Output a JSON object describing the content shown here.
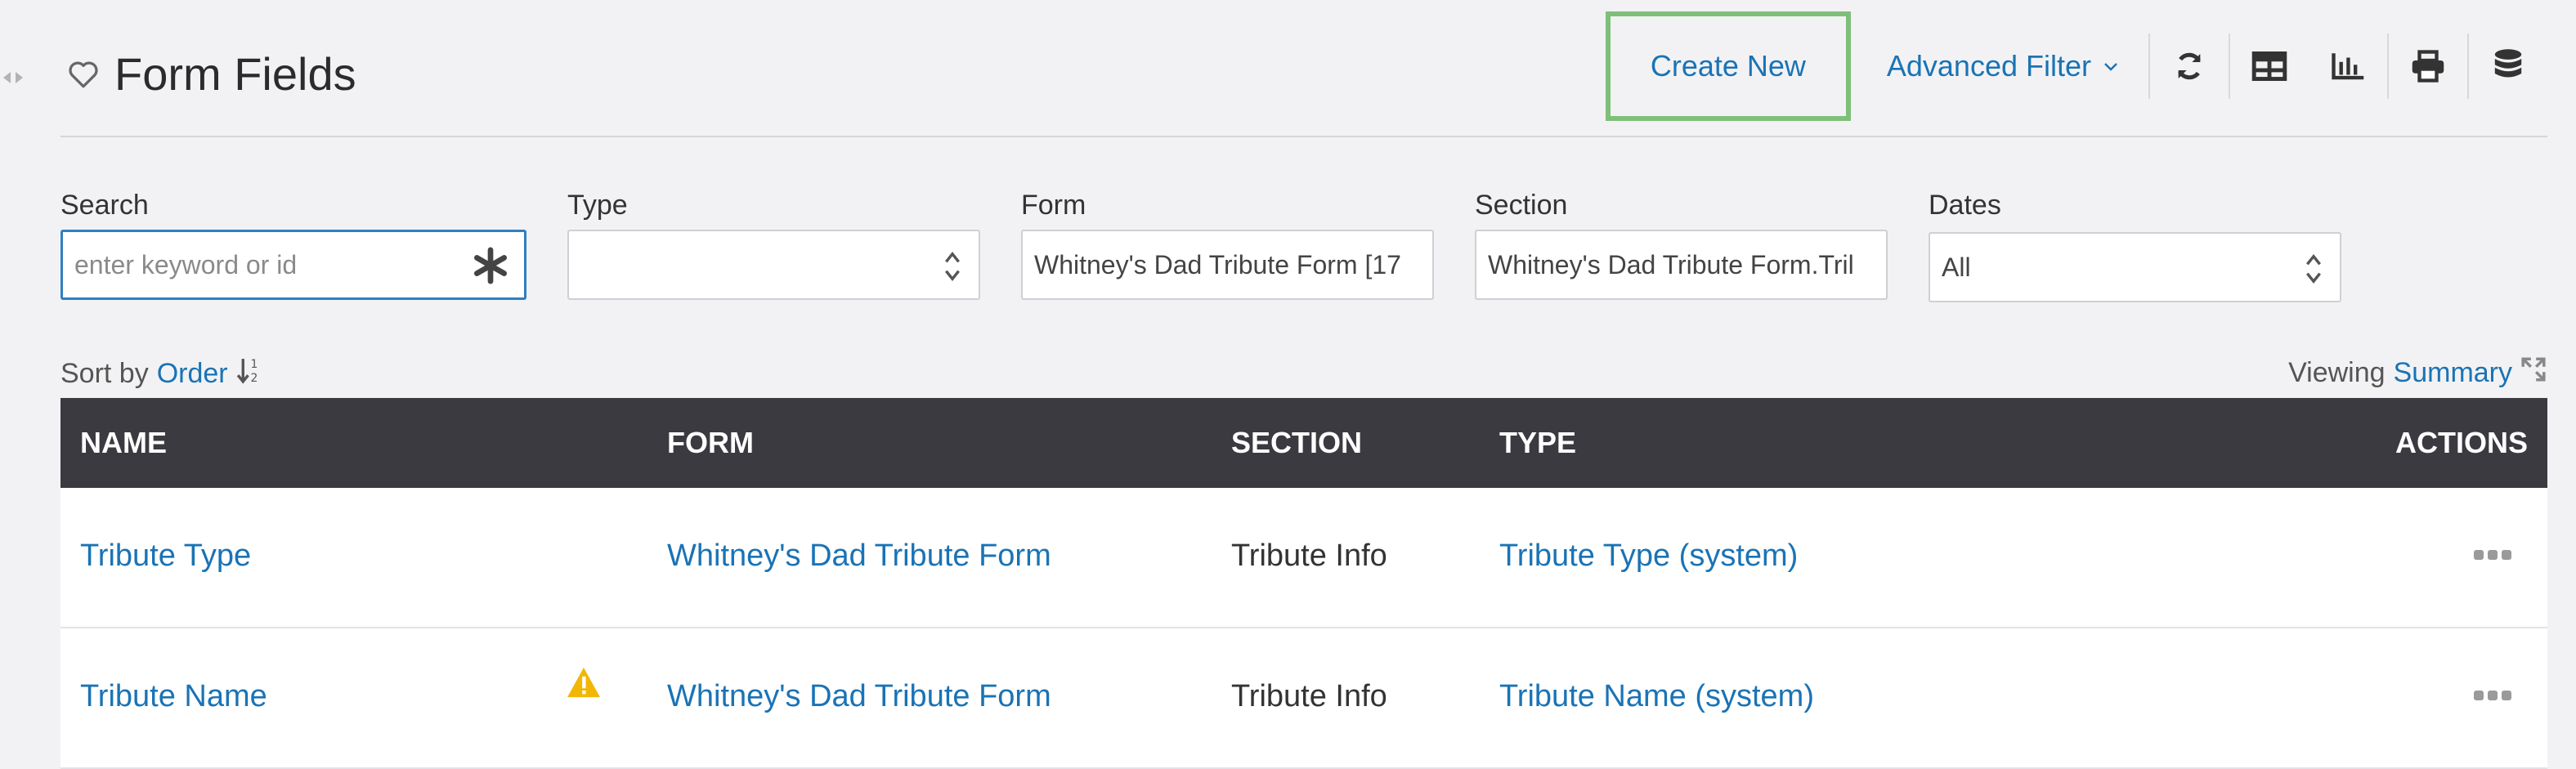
{
  "header": {
    "title": "Form Fields",
    "create_new": "Create New",
    "advanced_filter": "Advanced Filter"
  },
  "toolbar_icons": [
    "refresh-icon",
    "table-view-icon",
    "bar-chart-icon",
    "print-icon",
    "database-icon"
  ],
  "filters": {
    "search": {
      "label": "Search",
      "placeholder": "enter keyword or id",
      "value": ""
    },
    "type": {
      "label": "Type",
      "value": ""
    },
    "form": {
      "label": "Form",
      "value": "Whitney's Dad Tribute Form [17"
    },
    "section": {
      "label": "Section",
      "value": "Whitney's Dad Tribute Form.Tril"
    },
    "dates": {
      "label": "Dates",
      "value": "All"
    }
  },
  "sort": {
    "prefix": "Sort by",
    "field": "Order"
  },
  "view": {
    "prefix": "Viewing",
    "mode": "Summary"
  },
  "table": {
    "columns": {
      "name": "NAME",
      "form": "FORM",
      "section": "SECTION",
      "type": "TYPE",
      "actions": "ACTIONS"
    },
    "rows": [
      {
        "name": "Tribute Type",
        "form": "Whitney's Dad Tribute Form",
        "section": "Tribute Info",
        "type": "Tribute Type (system)"
      },
      {
        "name": "Tribute Name",
        "form": "Whitney's Dad Tribute Form",
        "section": "Tribute Info",
        "type": "Tribute Name (system)"
      }
    ]
  },
  "colors": {
    "link": "#1a73b5",
    "header_bg": "#3a3a40",
    "highlight_border": "#7fbf7a",
    "warning": "#f2b705"
  }
}
